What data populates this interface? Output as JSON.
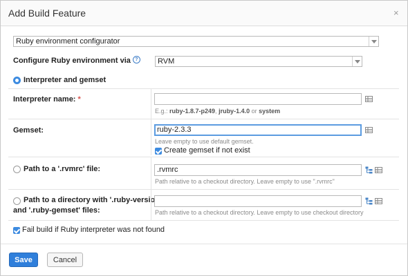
{
  "dialog": {
    "title": "Add Build Feature",
    "close_glyph": "×"
  },
  "feature_select": {
    "value": "Ruby environment configurator"
  },
  "configure": {
    "label": "Configure Ruby environment via",
    "help_glyph": "?",
    "value": "RVM"
  },
  "interpreter_gemset": {
    "label": "Interpreter and gemset"
  },
  "interpreter_name": {
    "label": "Interpreter name:",
    "required_mark": "*",
    "value": "",
    "hint_prefix": "E.g.: ",
    "hint_ex1": "ruby-1.8.7-p249",
    "hint_sep": ", ",
    "hint_ex2": "jruby-1.4.0",
    "hint_or": " or ",
    "hint_ex3": "system"
  },
  "gemset": {
    "label": "Gemset:",
    "value": "ruby-2.3.3",
    "hint": "Leave empty to use default gemset.",
    "create_label": "Create gemset if not exist"
  },
  "rvmrc": {
    "label": "Path to a '.rvmrc' file:",
    "value": ".rvmrc",
    "hint": "Path relative to a checkout directory. Leave empty to use \".rvmrc\""
  },
  "ruby_version": {
    "label_line1": "Path to a directory with '.ruby-version'",
    "label_line2": "and '.ruby-gemset' files:",
    "value": "",
    "hint": "Path relative to a checkout directory. Leave empty to use checkout directory"
  },
  "fail_build": {
    "label": "Fail build if Ruby interpreter was not found"
  },
  "buttons": {
    "save": "Save",
    "cancel": "Cancel"
  },
  "colors": {
    "accent": "#2f7fdb",
    "focus_border": "#5b9be0",
    "required": "#d9534f"
  }
}
